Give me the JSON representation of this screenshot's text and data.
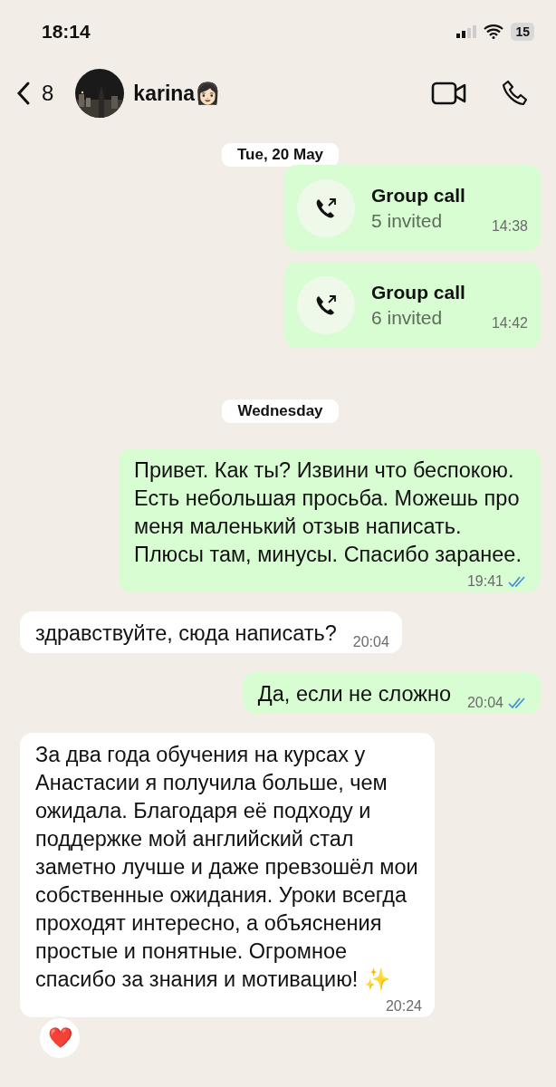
{
  "status_bar": {
    "time": "18:14",
    "battery": "15"
  },
  "header": {
    "back_count": "8",
    "name": "karina👩🏻"
  },
  "messages": [
    {
      "kind": "date",
      "text": "Tue, 20 May"
    },
    {
      "kind": "call",
      "outgoing": true,
      "title": "Group call",
      "subtitle": "5 invited",
      "time": "14:38"
    },
    {
      "kind": "call",
      "outgoing": true,
      "title": "Group call",
      "subtitle": "6 invited",
      "time": "14:42"
    },
    {
      "kind": "date",
      "text": "Wednesday"
    },
    {
      "kind": "text",
      "outgoing": true,
      "text": "Привет. Как ты? Извини что беспокою. Есть небольшая просьба. Можешь про меня маленький отзыв написать. Плюсы там, минусы. Спасибо заранее.",
      "time": "19:41",
      "read": true
    },
    {
      "kind": "text",
      "outgoing": false,
      "text": "здравствуйте, сюда написать?",
      "time": "20:04"
    },
    {
      "kind": "text",
      "outgoing": true,
      "text": "Да, если не сложно",
      "time": "20:04",
      "read": true
    },
    {
      "kind": "text",
      "outgoing": false,
      "text": "За два года обучения на курсах у Анастасии я получила больше, чем ожидала. Благодаря её подходу и поддержке мой английский стал заметно лучше и даже превзошёл мои собственные ожидания. Уроки всегда проходят интересно, а объяснения простые и понятные. Огромное спасибо за знания и мотивацию! ✨",
      "time": "20:24",
      "reaction": "❤️"
    }
  ]
}
